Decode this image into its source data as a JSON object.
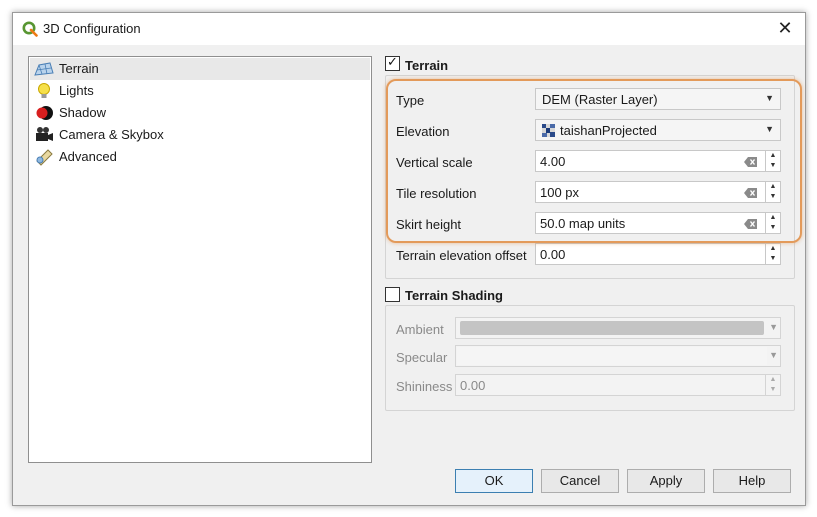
{
  "window": {
    "title": "3D Configuration",
    "close_glyph": "✕"
  },
  "sidebar": {
    "items": [
      {
        "label": "Terrain",
        "icon": "terrain-icon"
      },
      {
        "label": "Lights",
        "icon": "lightbulb-icon"
      },
      {
        "label": "Shadow",
        "icon": "shadow-icon"
      },
      {
        "label": "Camera & Skybox",
        "icon": "camera-icon"
      },
      {
        "label": "Advanced",
        "icon": "advanced-icon"
      }
    ],
    "selected_index": 0
  },
  "terrain": {
    "group_title": "Terrain",
    "checked": true,
    "type": {
      "label": "Type",
      "value": "DEM (Raster Layer)"
    },
    "elevation": {
      "label": "Elevation",
      "value": "taishanProjected"
    },
    "vertical_scale": {
      "label": "Vertical scale",
      "value": "4.00"
    },
    "tile_resolution": {
      "label": "Tile resolution",
      "value": "100 px"
    },
    "skirt_height": {
      "label": "Skirt height",
      "value": "50.0 map units"
    },
    "elevation_offset": {
      "label": "Terrain elevation offset",
      "value": "0.00"
    }
  },
  "shading": {
    "group_title": "Terrain Shading",
    "checked": false,
    "ambient_label": "Ambient",
    "specular_label": "Specular",
    "shininess": {
      "label": "Shininess",
      "value": "0.00"
    },
    "ambient_color": "#c4c4c4",
    "specular_color": "#f5f5f5"
  },
  "buttons": {
    "ok": "OK",
    "cancel": "Cancel",
    "apply": "Apply",
    "help": "Help"
  },
  "colors": {
    "highlight": "#e39a5a",
    "accent": "#3c7fb1"
  }
}
